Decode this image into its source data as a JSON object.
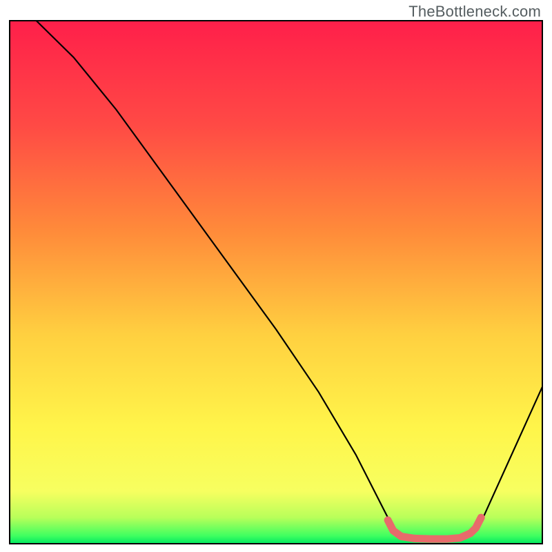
{
  "watermark": "TheBottleneck.com",
  "colors": {
    "curve_black": "#000000",
    "marker_red": "#e86b6b",
    "border": "#000000"
  },
  "chart_data": {
    "type": "line",
    "title": "",
    "xlabel": "",
    "ylabel": "",
    "xlim": [
      0,
      100
    ],
    "ylim": [
      0,
      100
    ],
    "grid": false,
    "axes_visible": false,
    "background_gradient": {
      "direction": "vertical",
      "stops": [
        {
          "pos": 0.0,
          "color": "#ff1f4a"
        },
        {
          "pos": 0.2,
          "color": "#ff4a45"
        },
        {
          "pos": 0.4,
          "color": "#ff8a3a"
        },
        {
          "pos": 0.6,
          "color": "#ffd040"
        },
        {
          "pos": 0.78,
          "color": "#fff54a"
        },
        {
          "pos": 0.9,
          "color": "#f7ff60"
        },
        {
          "pos": 0.95,
          "color": "#b8ff5a"
        },
        {
          "pos": 0.985,
          "color": "#3fff60"
        },
        {
          "pos": 1.0,
          "color": "#00e861"
        }
      ]
    },
    "curve": {
      "description": "V-shaped bottleneck curve. Steep descent from upper-left to a flat minimum basin near the lower right, then a short rise.",
      "points": [
        {
          "x": 5,
          "y": 100
        },
        {
          "x": 12,
          "y": 93
        },
        {
          "x": 20,
          "y": 83
        },
        {
          "x": 30,
          "y": 69
        },
        {
          "x": 40,
          "y": 55
        },
        {
          "x": 50,
          "y": 41
        },
        {
          "x": 58,
          "y": 29
        },
        {
          "x": 65,
          "y": 17
        },
        {
          "x": 70,
          "y": 7
        },
        {
          "x": 72,
          "y": 3
        },
        {
          "x": 74,
          "y": 1.5
        },
        {
          "x": 78,
          "y": 1
        },
        {
          "x": 83,
          "y": 1
        },
        {
          "x": 86,
          "y": 1.5
        },
        {
          "x": 88,
          "y": 3
        },
        {
          "x": 92,
          "y": 12
        },
        {
          "x": 96,
          "y": 21
        },
        {
          "x": 100,
          "y": 30
        }
      ]
    },
    "optimal_zone_markers": {
      "description": "Thick red segment highlighting the basin of the curve where bottleneck is near zero.",
      "points": [
        {
          "x": 71,
          "y": 4.5
        },
        {
          "x": 72,
          "y": 2.5
        },
        {
          "x": 73.5,
          "y": 1.4
        },
        {
          "x": 76,
          "y": 1.0
        },
        {
          "x": 79,
          "y": 0.9
        },
        {
          "x": 82,
          "y": 0.9
        },
        {
          "x": 84.5,
          "y": 1.1
        },
        {
          "x": 86.5,
          "y": 2.0
        },
        {
          "x": 87.5,
          "y": 3.0
        },
        {
          "x": 88.5,
          "y": 5.0
        }
      ]
    }
  }
}
